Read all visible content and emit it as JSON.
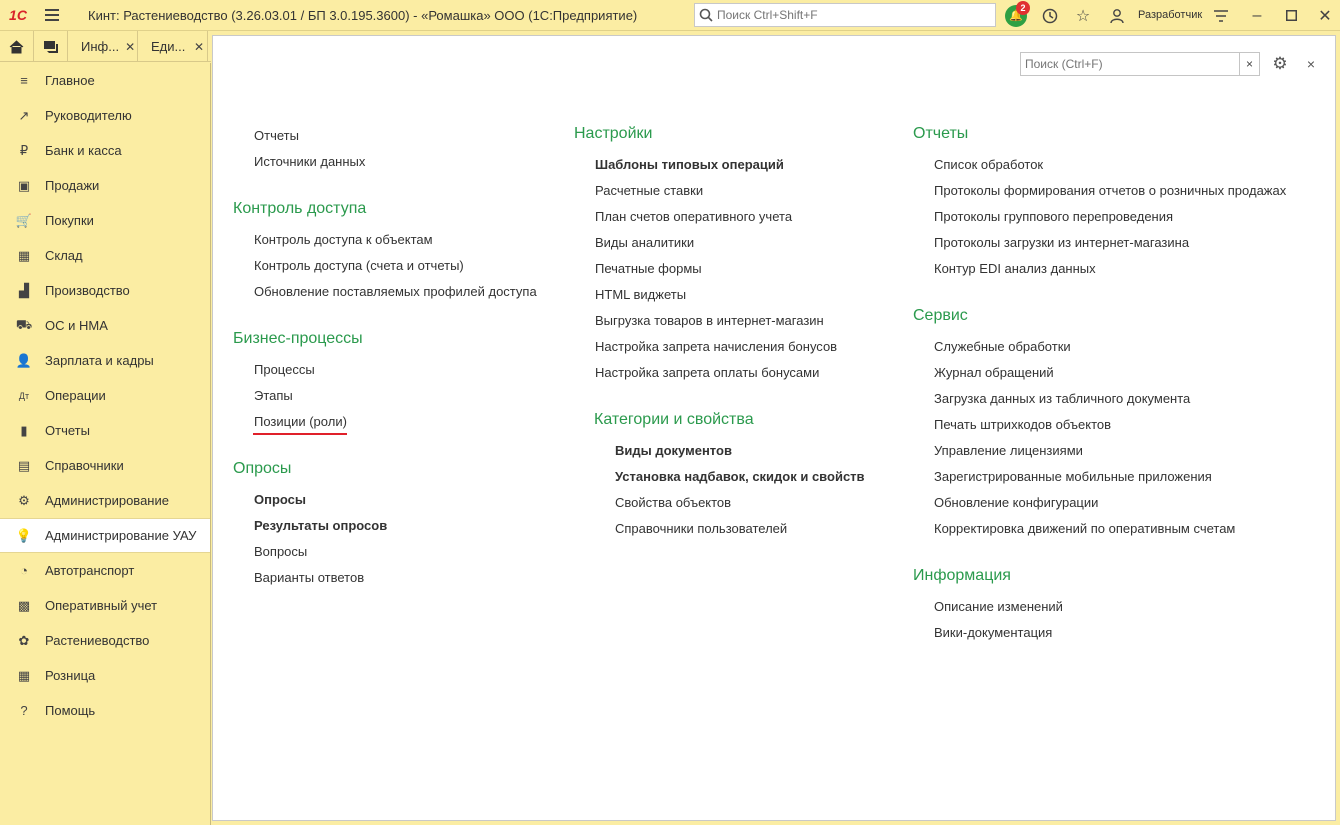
{
  "titlebar": {
    "logo": "1С",
    "title": "Кинт: Растениеводство (3.26.03.01 / БП 3.0.195.3600) - «Ромашка» ООО  (1С:Предприятие)",
    "search_placeholder": "Поиск Ctrl+Shift+F",
    "notifications_count": "2",
    "username": "Разработчик"
  },
  "tabs": [
    {
      "label": "Инф..."
    },
    {
      "label": "Еди..."
    }
  ],
  "sidebar": {
    "items": [
      {
        "label": "Главное",
        "icon": "≡"
      },
      {
        "label": "Руководителю",
        "icon": "↗"
      },
      {
        "label": "Банк и касса",
        "icon": "₽"
      },
      {
        "label": "Продажи",
        "icon": "▣"
      },
      {
        "label": "Покупки",
        "icon": "🛒"
      },
      {
        "label": "Склад",
        "icon": "▦"
      },
      {
        "label": "Производство",
        "icon": "▟"
      },
      {
        "label": "ОС и НМА",
        "icon": "⛟"
      },
      {
        "label": "Зарплата и кадры",
        "icon": "👤"
      },
      {
        "label": "Операции",
        "icon": "Дт"
      },
      {
        "label": "Отчеты",
        "icon": "▮"
      },
      {
        "label": "Справочники",
        "icon": "▤"
      },
      {
        "label": "Администрирование",
        "icon": "⚙"
      },
      {
        "label": "Администрирование УАУ",
        "icon": "💡"
      },
      {
        "label": "Автотранспорт",
        "icon": "◔"
      },
      {
        "label": "Оперативный учет",
        "icon": "▩"
      },
      {
        "label": "Растениеводство",
        "icon": "✿"
      },
      {
        "label": "Розница",
        "icon": "▦"
      },
      {
        "label": "Помощь",
        "icon": "?"
      }
    ]
  },
  "panel": {
    "search_placeholder": "Поиск (Ctrl+F)",
    "clear_label": "×",
    "close_label": "×",
    "col1": {
      "top_links": [
        "Отчеты",
        "Источники данных"
      ],
      "access": {
        "title": "Контроль доступа",
        "links": [
          "Контроль доступа к объектам",
          "Контроль доступа (счета и отчеты)",
          "Обновление поставляемых профилей доступа"
        ]
      },
      "bp": {
        "title": "Бизнес-процессы",
        "links": [
          "Процессы",
          "Этапы",
          "Позиции (роли)"
        ]
      },
      "surveys": {
        "title": "Опросы",
        "links": [
          "Опросы",
          "Результаты опросов",
          "Вопросы",
          "Варианты ответов"
        ]
      }
    },
    "col2": {
      "settings": {
        "title": "Настройки",
        "links": [
          "Шаблоны типовых операций",
          "Расчетные ставки",
          "План счетов оперативного учета",
          "Виды аналитики",
          "Печатные формы",
          "HTML виджеты",
          "Выгрузка товаров в интернет-магазин",
          "Настройка запрета начисления бонусов",
          "Настройка запрета оплаты бонусами"
        ]
      },
      "categories": {
        "title": "Категории и свойства",
        "links": [
          "Виды документов",
          "Установка надбавок, скидок и свойств",
          "Свойства объектов",
          "Справочники пользователей"
        ]
      }
    },
    "col3": {
      "reports": {
        "title": "Отчеты",
        "links": [
          "Список обработок",
          "Протоколы формирования отчетов о розничных продажах",
          "Протоколы группового перепроведения",
          "Протоколы загрузки из интернет-магазина",
          "Контур EDI анализ данных"
        ]
      },
      "service": {
        "title": "Сервис",
        "links": [
          "Служебные обработки",
          "Журнал обращений",
          "Загрузка данных из табличного документа",
          "Печать штрихкодов объектов",
          "Управление лицензиями",
          "Зарегистрированные мобильные приложения",
          "Обновление конфигурации",
          "Корректировка движений по оперативным счетам"
        ]
      },
      "info": {
        "title": "Информация",
        "links": [
          "Описание изменений",
          "Вики-документация"
        ]
      }
    }
  }
}
